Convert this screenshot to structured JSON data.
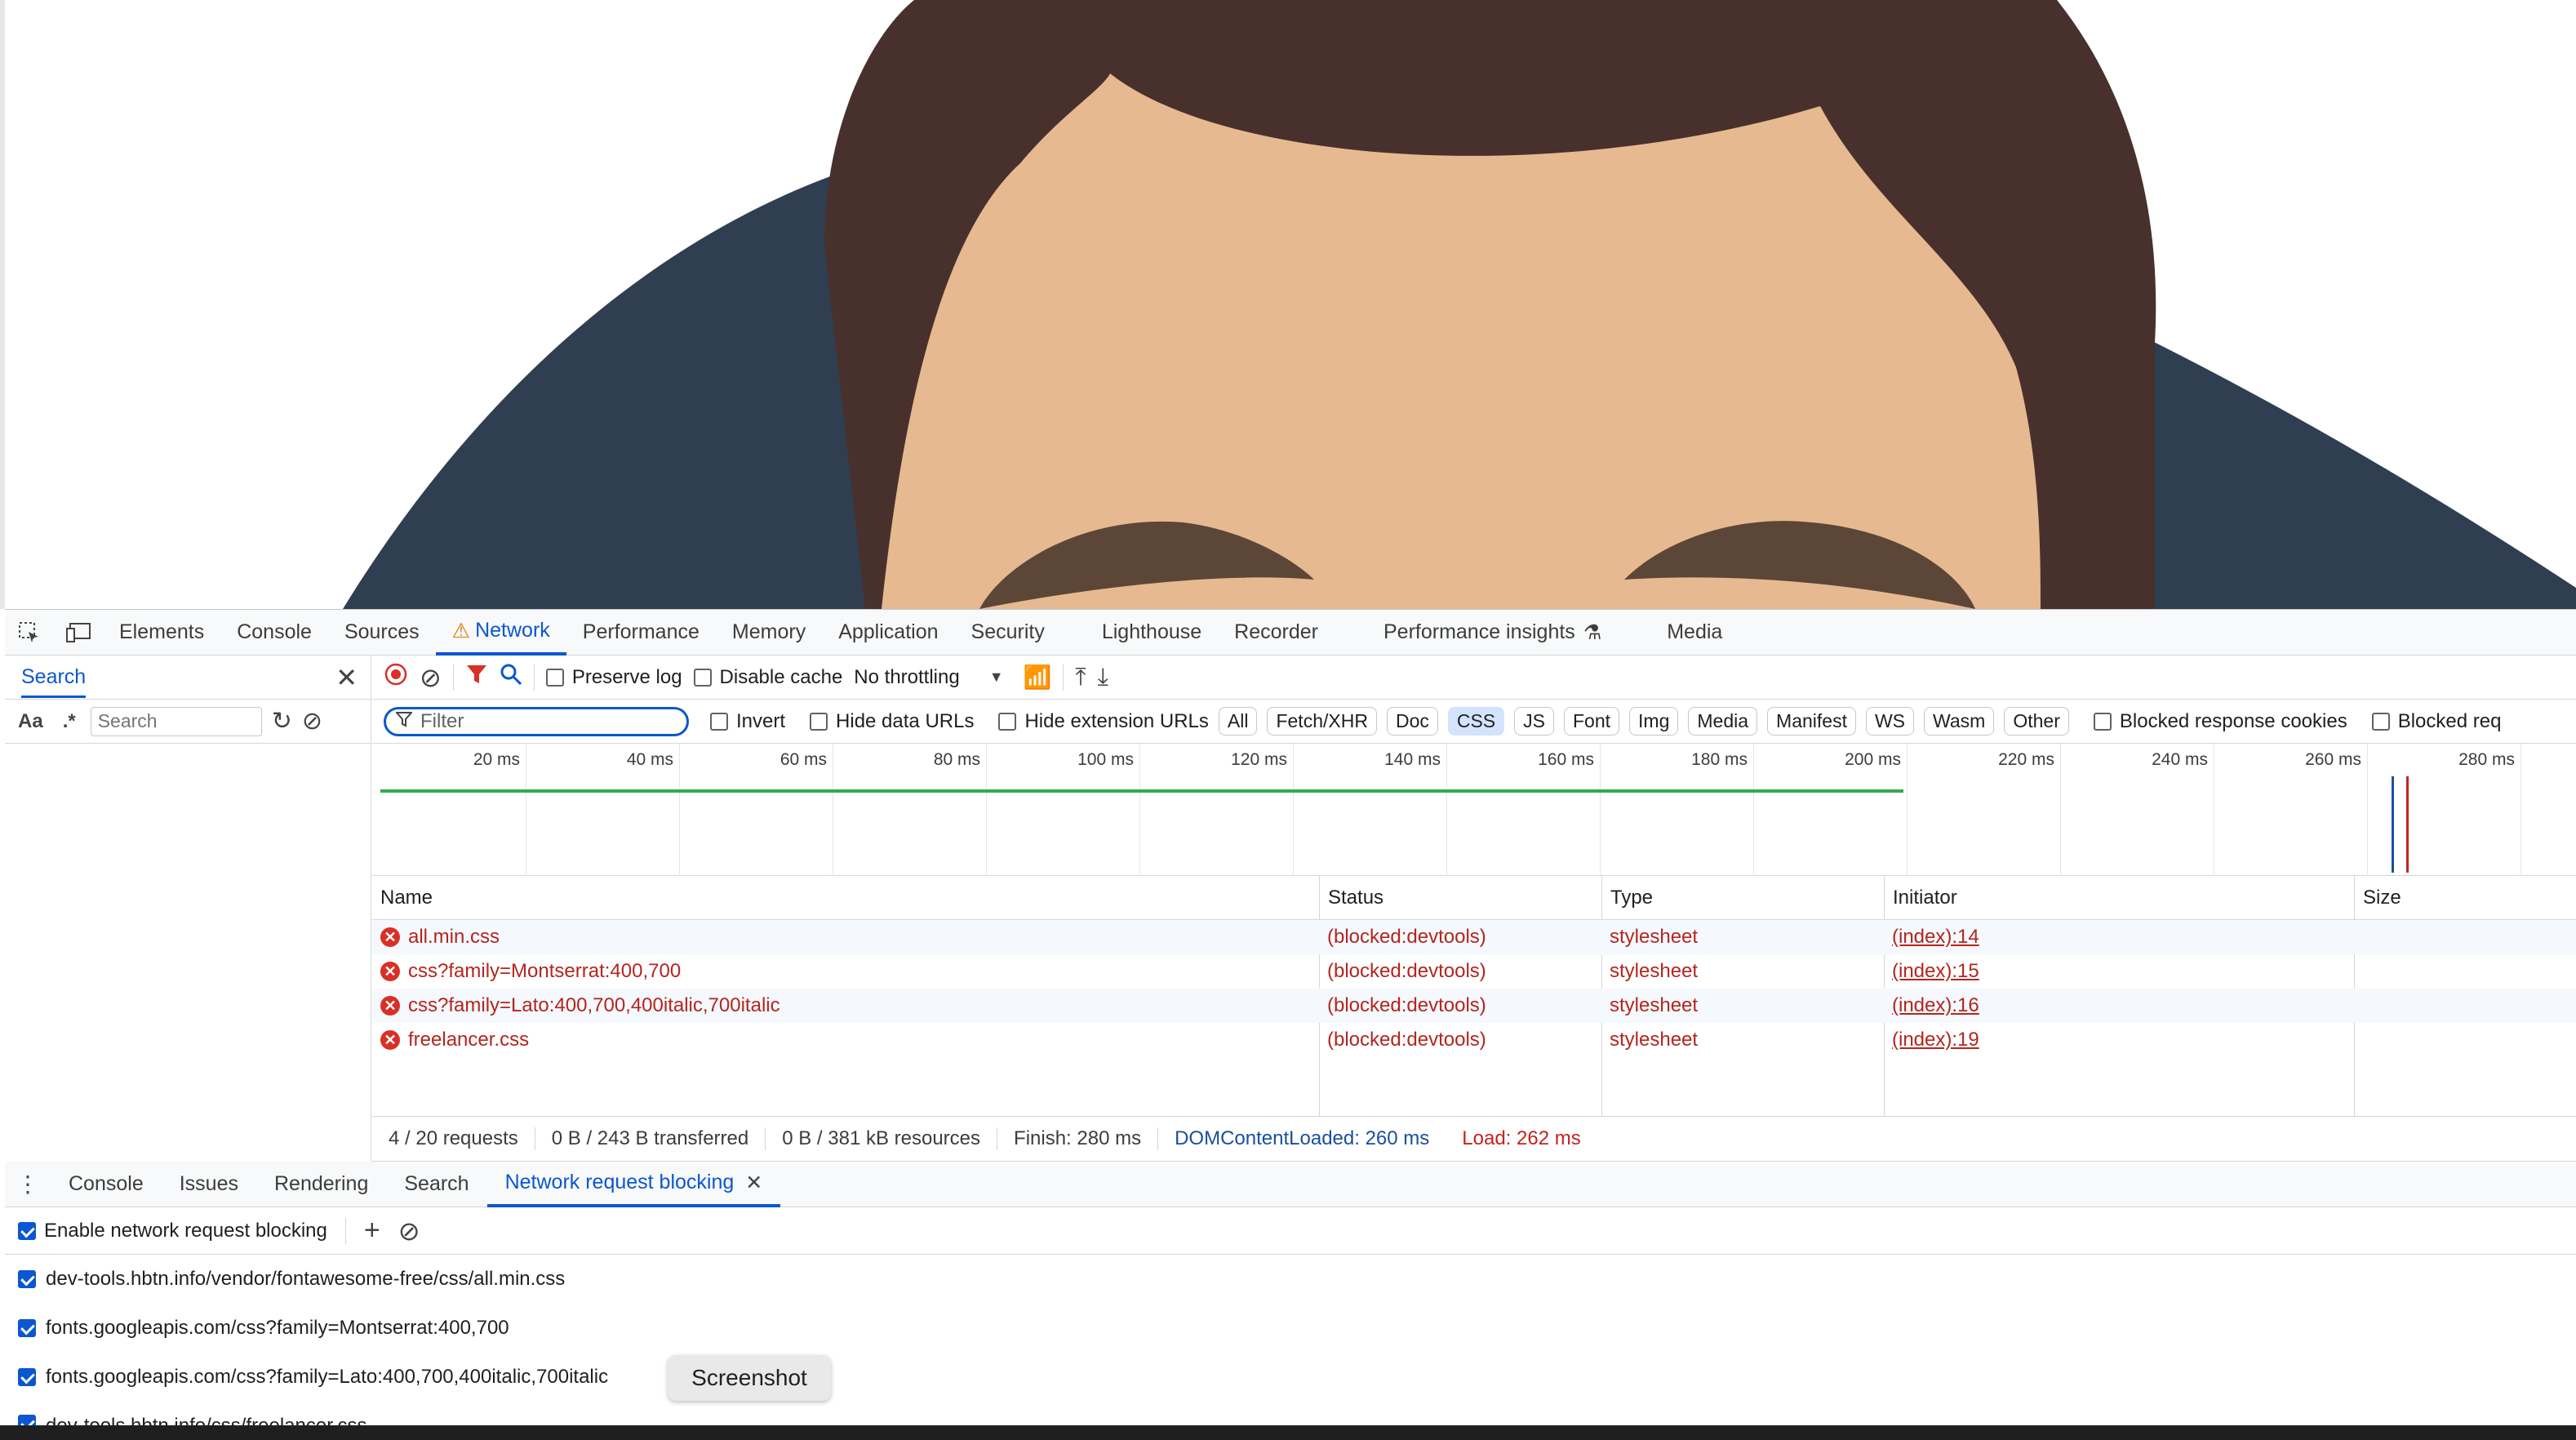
{
  "colors": {
    "accent": "#0b57d0",
    "error": "#b3261e",
    "hair": "#48312c",
    "skin": "#e6b991",
    "shirt": "#2f3e51",
    "brow": "#5c4638"
  },
  "devtools": {
    "main_tabs": [
      {
        "label": "Elements"
      },
      {
        "label": "Console"
      },
      {
        "label": "Sources"
      },
      {
        "label": "Network",
        "warning": true,
        "active": true
      },
      {
        "label": "Performance"
      },
      {
        "label": "Memory"
      },
      {
        "label": "Application"
      },
      {
        "label": "Security"
      },
      {
        "label": "Lighthouse"
      },
      {
        "label": "Recorder"
      },
      {
        "label": "Performance insights"
      },
      {
        "label": "Media"
      }
    ],
    "search_panel": {
      "title": "Search",
      "case_toggle": "Aa",
      "regex_toggle": ".*",
      "placeholder": "Search"
    },
    "toolbar": {
      "preserve_log": "Preserve log",
      "disable_cache": "Disable cache",
      "throttling": "No throttling"
    },
    "filter_bar": {
      "placeholder": "Filter",
      "invert": "Invert",
      "hide_data_urls": "Hide data URLs",
      "hide_extension_urls": "Hide extension URLs",
      "type_filters": [
        "All",
        "Fetch/XHR",
        "Doc",
        "CSS",
        "JS",
        "Font",
        "Img",
        "Media",
        "Manifest",
        "WS",
        "Wasm",
        "Other"
      ],
      "active_filter": "CSS",
      "blocked_response_cookies": "Blocked response cookies",
      "blocked_requests": "Blocked req"
    },
    "timeline_ticks": [
      "20 ms",
      "40 ms",
      "60 ms",
      "80 ms",
      "100 ms",
      "120 ms",
      "140 ms",
      "160 ms",
      "180 ms",
      "200 ms",
      "220 ms",
      "240 ms",
      "260 ms",
      "280 ms"
    ],
    "columns": [
      "Name",
      "Status",
      "Type",
      "Initiator",
      "Size"
    ],
    "requests": [
      {
        "name": "all.min.css",
        "status": "(blocked:devtools)",
        "type": "stylesheet",
        "initiator": "(index):14"
      },
      {
        "name": "css?family=Montserrat:400,700",
        "status": "(blocked:devtools)",
        "type": "stylesheet",
        "initiator": "(index):15"
      },
      {
        "name": "css?family=Lato:400,700,400italic,700italic",
        "status": "(blocked:devtools)",
        "type": "stylesheet",
        "initiator": "(index):16"
      },
      {
        "name": "freelancer.css",
        "status": "(blocked:devtools)",
        "type": "stylesheet",
        "initiator": "(index):19"
      }
    ],
    "summary": {
      "requests": "4 / 20 requests",
      "transferred": "0 B / 243 B transferred",
      "resources": "0 B / 381 kB resources",
      "finish": "Finish: 280 ms",
      "dom_content_loaded": "DOMContentLoaded: 260 ms",
      "load": "Load: 262 ms"
    },
    "drawer_tabs": [
      "Console",
      "Issues",
      "Rendering",
      "Search",
      "Network request blocking"
    ],
    "blocking": {
      "enable_label": "Enable network request blocking",
      "patterns": [
        "dev-tools.hbtn.info/vendor/fontawesome-free/css/all.min.css",
        "fonts.googleapis.com/css?family=Montserrat:400,700",
        "fonts.googleapis.com/css?family=Lato:400,700,400italic,700italic",
        "dev-tools.hbtn.info/css/freelancer.css"
      ]
    },
    "tooltip": "Screenshot"
  }
}
